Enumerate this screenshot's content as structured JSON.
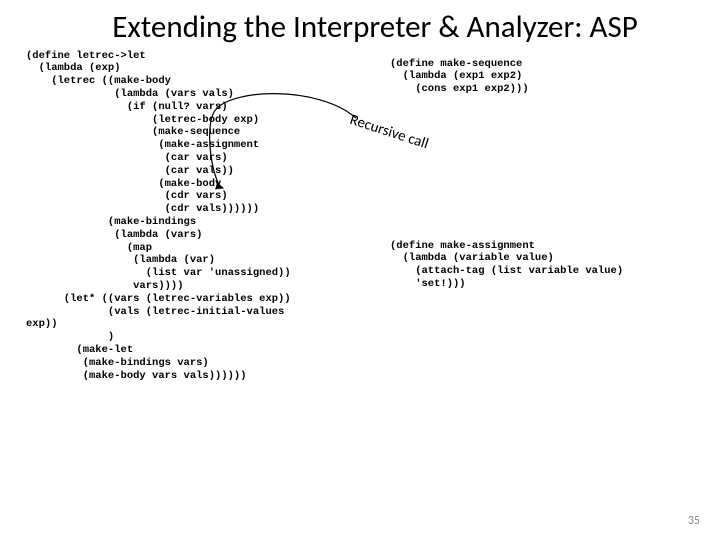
{
  "title": "Extending the Interpreter & Analyzer: ASP",
  "code_left": "(define letrec->let\n  (lambda (exp)\n    (letrec ((make-body\n              (lambda (vars vals)\n                (if (null? vars)\n                    (letrec-body exp)\n                    (make-sequence\n                     (make-assignment\n                      (car vars)\n                      (car vals))\n                     (make-body\n                      (cdr vars)\n                      (cdr vals))))))\n             (make-bindings\n              (lambda (vars)\n                (map\n                 (lambda (var)\n                   (list var 'unassigned))\n                 vars))))\n      (let* ((vars (letrec-variables exp))\n             (vals (letrec-initial-values\nexp))\n             )\n        (make-let\n         (make-bindings vars)\n         (make-body vars vals))))))",
  "code_right_1": "(define make-sequence\n  (lambda (exp1 exp2)\n    (cons exp1 exp2)))",
  "code_right_2": "(define make-assignment\n  (lambda (variable value)\n    (attach-tag (list variable value)\n    'set!)))",
  "annotation": "Recursive call",
  "page_number": "35"
}
